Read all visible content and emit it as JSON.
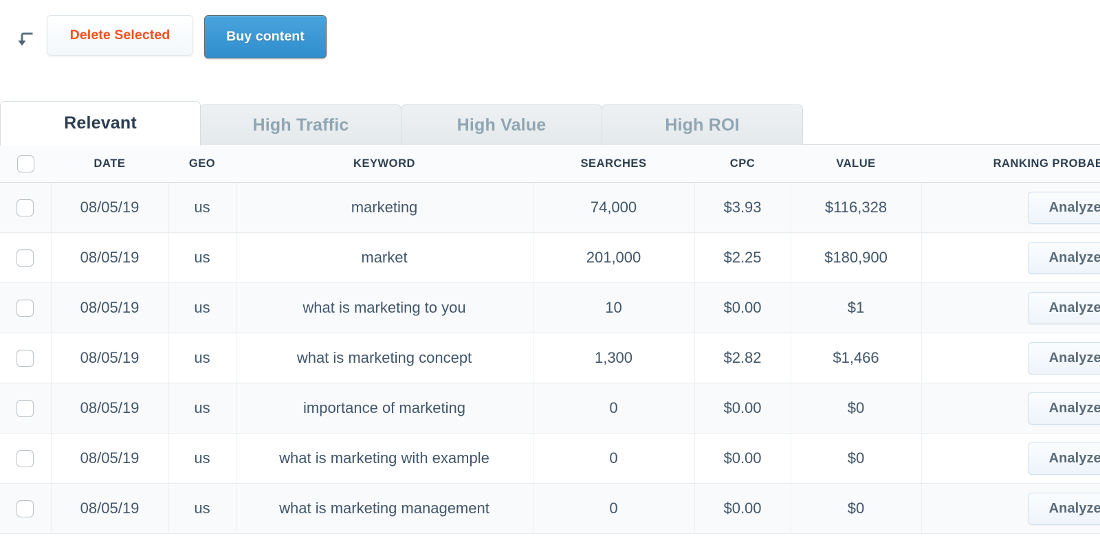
{
  "toolbar": {
    "return_arrow_icon": "return-arrow-icon",
    "delete_selected_label": "Delete Selected",
    "buy_content_label": "Buy content",
    "delete_color": "#f4511e",
    "buy_color": "#3d96d6"
  },
  "tabs": [
    {
      "label": "Relevant",
      "active": true
    },
    {
      "label": "High Traffic",
      "active": false
    },
    {
      "label": "High Value",
      "active": false
    },
    {
      "label": "High ROI",
      "active": false
    }
  ],
  "table": {
    "columns": [
      {
        "key": "select",
        "label": ""
      },
      {
        "key": "date",
        "label": "DATE"
      },
      {
        "key": "geo",
        "label": "GEO"
      },
      {
        "key": "keyword",
        "label": "KEYWORD"
      },
      {
        "key": "searches",
        "label": "SEARCHES"
      },
      {
        "key": "cpc",
        "label": "CPC"
      },
      {
        "key": "value",
        "label": "VALUE"
      },
      {
        "key": "ranking",
        "label": "RANKING PROBABILITY"
      }
    ],
    "action_label": "Analyze",
    "rows": [
      {
        "date": "08/05/19",
        "geo": "us",
        "keyword": "marketing",
        "searches": "74,000",
        "cpc": "$3.93",
        "value": "$116,328",
        "action": "Analyze"
      },
      {
        "date": "08/05/19",
        "geo": "us",
        "keyword": "market",
        "searches": "201,000",
        "cpc": "$2.25",
        "value": "$180,900",
        "action": "Analyze"
      },
      {
        "date": "08/05/19",
        "geo": "us",
        "keyword": "what is marketing to you",
        "searches": "10",
        "cpc": "$0.00",
        "value": "$1",
        "action": "Analyze"
      },
      {
        "date": "08/05/19",
        "geo": "us",
        "keyword": "what is marketing concept",
        "searches": "1,300",
        "cpc": "$2.82",
        "value": "$1,466",
        "action": "Analyze"
      },
      {
        "date": "08/05/19",
        "geo": "us",
        "keyword": "importance of marketing",
        "searches": "0",
        "cpc": "$0.00",
        "value": "$0",
        "action": "Analyze"
      },
      {
        "date": "08/05/19",
        "geo": "us",
        "keyword": "what is marketing with example",
        "searches": "0",
        "cpc": "$0.00",
        "value": "$0",
        "action": "Analyze"
      },
      {
        "date": "08/05/19",
        "geo": "us",
        "keyword": "what is marketing management",
        "searches": "0",
        "cpc": "$0.00",
        "value": "$0",
        "action": "Analyze"
      }
    ]
  }
}
